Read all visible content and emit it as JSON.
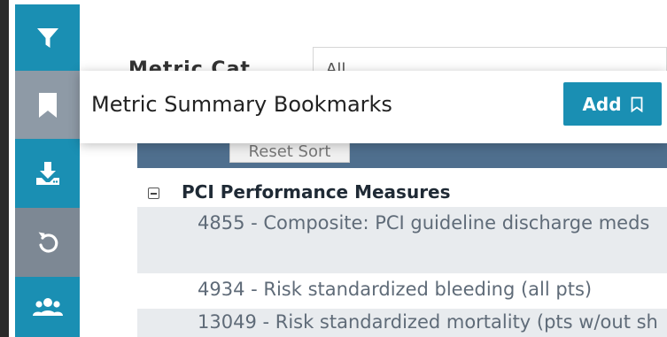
{
  "sidebar": {
    "buttons": [
      {
        "name": "filter",
        "icon": "filter-icon"
      },
      {
        "name": "bookmarks",
        "icon": "bookmark-icon"
      },
      {
        "name": "download",
        "icon": "download-icon"
      },
      {
        "name": "reset",
        "icon": "reset-icon"
      },
      {
        "name": "groups",
        "icon": "users-icon"
      }
    ],
    "colors": {
      "active": "#1a8fb3",
      "muted": "#8e9aa6"
    }
  },
  "filters": {
    "metric_category_label": "Metric Cat",
    "metric_category_value": "All"
  },
  "bookmarks_popup": {
    "title": "Metric Summary Bookmarks",
    "add_label": "Add"
  },
  "table": {
    "reset_sort_label": "Reset Sort",
    "group": {
      "title": "PCI Performance Measures"
    },
    "rows": [
      {
        "label": "4855 - Composite: PCI guideline discharge meds"
      },
      {
        "label": "4934 - Risk standardized bleeding (all pts)"
      },
      {
        "label": "13049 - Risk standardized mortality (pts w/out sh"
      }
    ]
  }
}
